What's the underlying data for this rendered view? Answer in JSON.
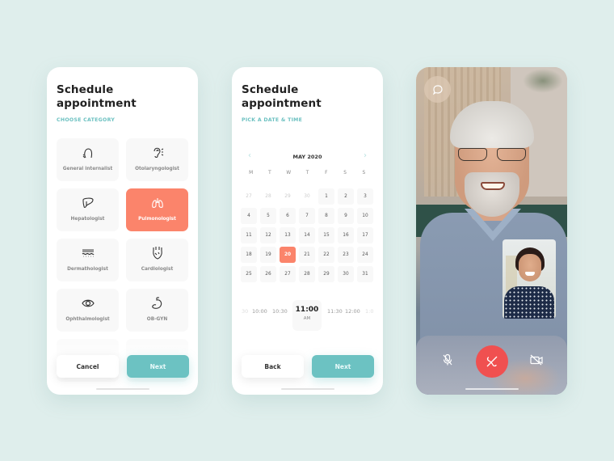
{
  "screen1": {
    "title_line1": "Schedule",
    "title_line2": "appointment",
    "subtitle": "CHOOSE CATEGORY",
    "categories": [
      {
        "label": "General internalist",
        "icon": "head-profile-icon",
        "active": false
      },
      {
        "label": "Otolaryngologist",
        "icon": "ear-icon",
        "active": false
      },
      {
        "label": "Hepatologist",
        "icon": "liver-icon",
        "active": false
      },
      {
        "label": "Pulmonologist",
        "icon": "lungs-icon",
        "active": true
      },
      {
        "label": "Dermathologist",
        "icon": "skin-layers-icon",
        "active": false
      },
      {
        "label": "Cardiologist",
        "icon": "heart-icon",
        "active": false
      },
      {
        "label": "Ophthalmologist",
        "icon": "eye-icon",
        "active": false
      },
      {
        "label": "OB-GYN",
        "icon": "stomach-icon",
        "active": false
      }
    ],
    "cancel_label": "Cancel",
    "next_label": "Next"
  },
  "screen2": {
    "title_line1": "Schedule",
    "title_line2": "appointment",
    "subtitle": "PICK A DATE & TIME",
    "month": "MAY 2020",
    "weekdays": [
      "M",
      "T",
      "W",
      "T",
      "F",
      "S",
      "S"
    ],
    "days": [
      {
        "d": "27",
        "muted": true
      },
      {
        "d": "28",
        "muted": true
      },
      {
        "d": "29",
        "muted": true
      },
      {
        "d": "30",
        "muted": true
      },
      {
        "d": "1"
      },
      {
        "d": "2"
      },
      {
        "d": "3"
      },
      {
        "d": "4"
      },
      {
        "d": "5"
      },
      {
        "d": "6"
      },
      {
        "d": "7"
      },
      {
        "d": "8"
      },
      {
        "d": "9"
      },
      {
        "d": "10"
      },
      {
        "d": "11"
      },
      {
        "d": "12"
      },
      {
        "d": "13"
      },
      {
        "d": "14"
      },
      {
        "d": "15"
      },
      {
        "d": "16"
      },
      {
        "d": "17"
      },
      {
        "d": "18"
      },
      {
        "d": "19"
      },
      {
        "d": "20",
        "selected": true
      },
      {
        "d": "21"
      },
      {
        "d": "22"
      },
      {
        "d": "23"
      },
      {
        "d": "24"
      },
      {
        "d": "25"
      },
      {
        "d": "26"
      },
      {
        "d": "27"
      },
      {
        "d": "28"
      },
      {
        "d": "29"
      },
      {
        "d": "30"
      },
      {
        "d": "31"
      }
    ],
    "times": {
      "before": [
        "30",
        "10:00",
        "10:30"
      ],
      "selected": "11:00",
      "selected_period": "AM",
      "after": [
        "11:30",
        "12:00",
        "1:0"
      ]
    },
    "back_label": "Back",
    "next_label": "Next"
  },
  "screen3": {
    "chat_icon": "chat-bubble-icon",
    "controls": {
      "mute": "mic-off-icon",
      "end_call": "phone-hangup-icon",
      "camera": "camera-off-icon"
    },
    "colors": {
      "end_call": "#f05050"
    }
  },
  "colors": {
    "accent": "#6cc2c2",
    "highlight": "#fb846b",
    "background": "#dfeeec"
  }
}
